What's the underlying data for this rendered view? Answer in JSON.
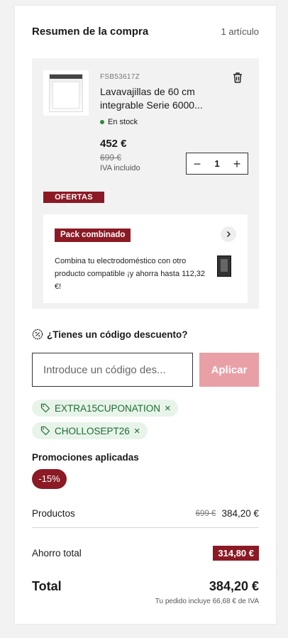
{
  "header": {
    "title": "Resumen de la compra",
    "count": "1 artículo"
  },
  "item": {
    "sku": "FSB53617Z",
    "name": "Lavavajillas de 60 cm integrable Serie 6000...",
    "stock": "En stock",
    "price": "452 €",
    "old_price": "699 €",
    "iva": "IVA incluido",
    "quantity": "1",
    "offer_label": "OFERTAS",
    "icons": [
      "trash-icon",
      "minus-icon",
      "plus-icon"
    ]
  },
  "pack": {
    "tag": "Pack combinado",
    "description": "Combina tu electrodoméstico con otro producto compatible ¡y ahorra hasta 112,32 €!",
    "icon": "chevron-right-icon"
  },
  "discount": {
    "heading": "¿Tienes un código descuento?",
    "placeholder": "Introduce un código des...",
    "apply_label": "Aplicar",
    "coupons": [
      "EXTRA15CUPONATION",
      "CHOLLOSEPT26"
    ],
    "icon": "percent-badge-icon"
  },
  "promotions": {
    "heading": "Promociones aplicadas",
    "badge": "-15%"
  },
  "summary": {
    "products_label": "Productos",
    "products_old": "699 €",
    "products_value": "384,20 €",
    "saving_label": "Ahorro total",
    "saving_value": "314,80 €",
    "total_label": "Total",
    "total_value": "384,20 €",
    "iva_note": "Tu pedido incluye 66,68 € de IVA"
  },
  "colors": {
    "brand": "#8b1a24",
    "apply_button": "#e8a0a6",
    "coupon_chip_bg": "#e8f4ea",
    "coupon_text": "#1e6b32",
    "stock_dot": "#2e8b3c"
  }
}
